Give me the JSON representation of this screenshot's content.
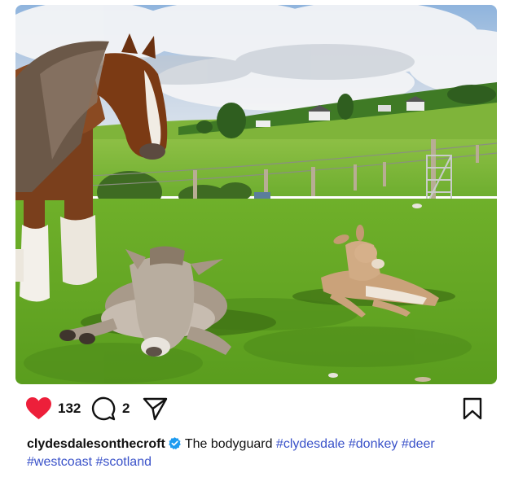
{
  "photo": {
    "alt_subject": "clydesdale-donkey-deer-photo"
  },
  "actions": {
    "like_count": "132",
    "comment_count": "2"
  },
  "caption": {
    "username": "clydesdalesonthecroft",
    "text": "The bodyguard",
    "hashtags": [
      "#clydesdale",
      "#donkey",
      "#deer",
      "#westcoast",
      "#scotland"
    ]
  },
  "colors": {
    "like_red": "#ed1f3a",
    "verified_blue": "#1d9bf0",
    "hashtag_blue": "#3a52c9"
  },
  "icons": {
    "like": "heart-icon",
    "comment": "comment-bubble-icon",
    "share": "send-paper-plane-icon",
    "save": "bookmark-icon",
    "verified": "verified-badge-icon"
  }
}
